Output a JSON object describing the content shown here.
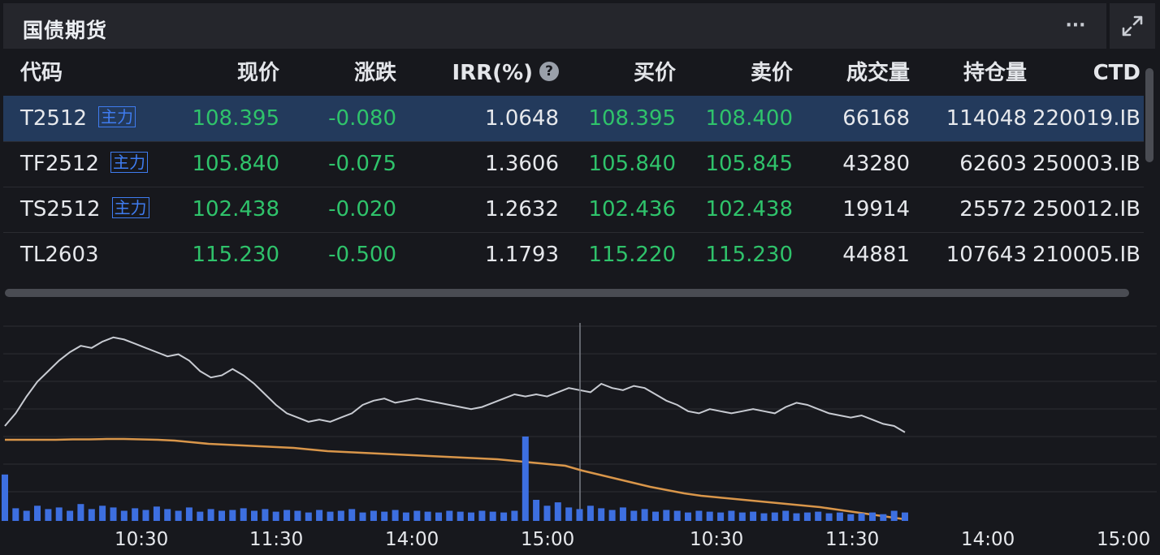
{
  "header": {
    "title": "国债期货",
    "more_label": "···",
    "expand_icon": "expand-icon"
  },
  "table": {
    "columns": [
      "代码",
      "现价",
      "涨跌",
      "IRR(%)",
      "买价",
      "卖价",
      "成交量",
      "持仓量",
      "CTD"
    ],
    "irr_help": "?",
    "rows": [
      {
        "code": "T2512",
        "tag": "主力",
        "price": "108.395",
        "change": "-0.080",
        "irr": "1.0648",
        "bid": "108.395",
        "ask": "108.400",
        "volume": "66168",
        "oi": "114048",
        "ctd": "220019.IB"
      },
      {
        "code": "TF2512",
        "tag": "主力",
        "price": "105.840",
        "change": "-0.075",
        "irr": "1.3606",
        "bid": "105.840",
        "ask": "105.845",
        "volume": "43280",
        "oi": "62603",
        "ctd": "250003.IB"
      },
      {
        "code": "TS2512",
        "tag": "主力",
        "price": "102.438",
        "change": "-0.020",
        "irr": "1.2632",
        "bid": "102.436",
        "ask": "102.438",
        "volume": "19914",
        "oi": "25572",
        "ctd": "250012.IB"
      },
      {
        "code": "TL2603",
        "tag": "",
        "price": "115.230",
        "change": "-0.500",
        "irr": "1.1793",
        "bid": "115.220",
        "ask": "115.230",
        "volume": "44881",
        "oi": "107643",
        "ctd": "210005.IB"
      }
    ]
  },
  "colors": {
    "background": "#17181d",
    "up_green": "#2fc36b",
    "selected_row": "#233a5c",
    "tag_blue": "#3f7cf0",
    "price_line": "#c8cbd2",
    "avg_line": "#d9964a",
    "volume_bar": "#3d6fe0"
  },
  "chart_data": {
    "type": "line",
    "x_tick_labels": [
      "10:30",
      "11:30",
      "14:00",
      "15:00",
      "10:30",
      "11:30",
      "14:00",
      "15:00"
    ],
    "series": [],
    "grid": true,
    "ylim": [
      0,
      1
    ],
    "price_values": [
      0.1,
      0.22,
      0.38,
      0.52,
      0.62,
      0.72,
      0.8,
      0.86,
      0.84,
      0.9,
      0.94,
      0.92,
      0.88,
      0.84,
      0.8,
      0.76,
      0.78,
      0.72,
      0.62,
      0.56,
      0.58,
      0.64,
      0.58,
      0.5,
      0.4,
      0.3,
      0.22,
      0.18,
      0.14,
      0.16,
      0.14,
      0.18,
      0.22,
      0.3,
      0.34,
      0.36,
      0.32,
      0.34,
      0.36,
      0.34,
      0.32,
      0.3,
      0.28,
      0.26,
      0.28,
      0.32,
      0.36,
      0.4,
      0.38,
      0.4,
      0.38,
      0.42,
      0.46,
      0.44,
      0.42,
      0.5,
      0.46,
      0.44,
      0.48,
      0.46,
      0.4,
      0.34,
      0.3,
      0.24,
      0.22,
      0.26,
      0.24,
      0.22,
      0.24,
      0.26,
      0.24,
      0.22,
      0.28,
      0.32,
      0.3,
      0.26,
      0.22,
      0.2,
      0.18,
      0.2,
      0.16,
      0.12,
      0.1,
      0.04
    ],
    "avg_values": [
      0.98,
      0.98,
      0.98,
      0.98,
      0.985,
      0.985,
      0.99,
      0.99,
      0.985,
      0.98,
      0.97,
      0.95,
      0.93,
      0.92,
      0.91,
      0.9,
      0.89,
      0.88,
      0.86,
      0.84,
      0.83,
      0.82,
      0.81,
      0.8,
      0.79,
      0.78,
      0.77,
      0.76,
      0.75,
      0.74,
      0.72,
      0.7,
      0.68,
      0.66,
      0.6,
      0.55,
      0.5,
      0.45,
      0.4,
      0.36,
      0.32,
      0.29,
      0.27,
      0.25,
      0.23,
      0.21,
      0.19,
      0.17,
      0.15,
      0.12,
      0.09,
      0.06,
      0.03,
      0.0
    ],
    "volume_values": [
      0.55,
      0.15,
      0.12,
      0.18,
      0.14,
      0.16,
      0.12,
      0.2,
      0.14,
      0.18,
      0.16,
      0.12,
      0.15,
      0.13,
      0.17,
      0.14,
      0.12,
      0.16,
      0.11,
      0.14,
      0.12,
      0.13,
      0.15,
      0.12,
      0.14,
      0.11,
      0.13,
      0.12,
      0.1,
      0.13,
      0.11,
      0.12,
      0.14,
      0.1,
      0.12,
      0.11,
      0.13,
      0.1,
      0.12,
      0.11,
      0.1,
      0.12,
      0.11,
      0.1,
      0.12,
      0.11,
      0.1,
      0.12,
      1.0,
      0.25,
      0.18,
      0.22,
      0.16,
      0.14,
      0.18,
      0.15,
      0.13,
      0.16,
      0.12,
      0.14,
      0.11,
      0.13,
      0.12,
      0.1,
      0.12,
      0.11,
      0.1,
      0.12,
      0.1,
      0.11,
      0.09,
      0.1,
      0.12,
      0.09,
      0.1,
      0.11,
      0.09,
      0.1,
      0.08,
      0.09,
      0.1,
      0.08,
      0.12,
      0.1
    ]
  }
}
